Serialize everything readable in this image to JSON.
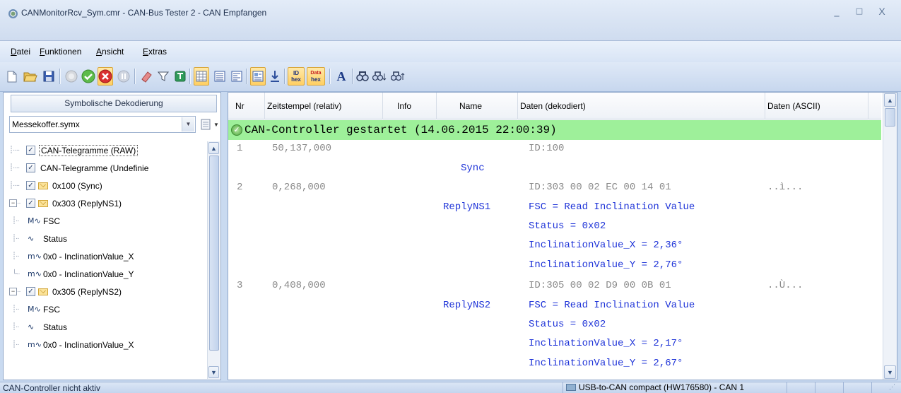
{
  "window": {
    "title": "CANMonitorRcv_Sym.cmr - CAN-Bus Tester 2 - CAN Empfangen",
    "controls": {
      "minimize": "_",
      "maximize": "□",
      "close": "X"
    }
  },
  "menu": {
    "items": [
      {
        "label": "Datei",
        "underline": "D",
        "rest": "atei"
      },
      {
        "label": "Funktionen",
        "underline": "F",
        "rest": "unktionen"
      },
      {
        "label": "Ansicht",
        "underline": "A",
        "rest": "nsicht"
      },
      {
        "label": "Extras",
        "underline": "E",
        "rest": "xtras"
      }
    ]
  },
  "toolbar": {
    "icons": [
      "new-file-icon",
      "open-folder-icon",
      "save-icon",
      "stop-gray-icon",
      "start-green-icon",
      "stop-red-icon",
      "pause-icon",
      "eraser-icon",
      "filter-icon",
      "trigger-icon",
      "grid-icon",
      "list-view-icon",
      "list-view-2-icon",
      "symbolic-icon",
      "scroll-down-icon",
      "id-hex-icon",
      "data-hex-icon",
      "font-icon",
      "find-icon",
      "find-next-icon",
      "find-prev-icon"
    ],
    "id_hex_top": "ID",
    "id_hex_bottom": "hex",
    "data_hex_top": "Data",
    "data_hex_bottom": "hex",
    "font_label": "A"
  },
  "left_panel": {
    "header": "Symbolische Dekodierung",
    "combo_value": "Messekoffer.symx",
    "tree": [
      {
        "label": "CAN-Telegramme (RAW)",
        "checked": true,
        "kind": "check"
      },
      {
        "label": "CAN-Telegramme (Undefinie",
        "checked": true,
        "kind": "check"
      },
      {
        "label": "0x100 (Sync)",
        "checked": true,
        "kind": "msg"
      },
      {
        "label": "0x303 (ReplyNS1)",
        "checked": true,
        "kind": "msg-expanded"
      },
      {
        "label": "FSC",
        "sig": "M∿",
        "kind": "sig"
      },
      {
        "label": "Status",
        "sig": "∿",
        "kind": "sig"
      },
      {
        "label": "0x0 - InclinationValue_X",
        "sig": "m∿",
        "kind": "sig"
      },
      {
        "label": "0x0 - InclinationValue_Y",
        "sig": "m∿",
        "kind": "sig-last"
      },
      {
        "label": "0x305 (ReplyNS2)",
        "checked": true,
        "kind": "msg-expanded"
      },
      {
        "label": "FSC",
        "sig": "M∿",
        "kind": "sig"
      },
      {
        "label": "Status",
        "sig": "∿",
        "kind": "sig"
      },
      {
        "label": "0x0 - InclinationValue_X",
        "sig": "m∿",
        "kind": "sig"
      }
    ]
  },
  "table": {
    "columns": [
      "Nr",
      "Zeitstempel (relativ)",
      "Info",
      "Name",
      "Daten (dekodiert)",
      "Daten (ASCII)"
    ],
    "banner": "CAN-Controller gestartet (14.06.2015  22:00:39)",
    "rows": [
      {
        "nr": "1",
        "time": "50,137,000",
        "data": "ID:100",
        "ascii": ""
      },
      {
        "name": "Sync"
      },
      {
        "nr": "2",
        "time": "0,268,000",
        "data": "ID:303  00 02 EC 00 14 01",
        "ascii": "..ì..."
      },
      {
        "name": "ReplyNS1",
        "decoded": "FSC = Read Inclination Value"
      },
      {
        "decoded": "Status = 0x02"
      },
      {
        "decoded": "InclinationValue_X = 2,36°"
      },
      {
        "decoded": "InclinationValue_Y = 2,76°"
      },
      {
        "nr": "3",
        "time": "0,408,000",
        "data": "ID:305  00 02 D9 00 0B 01",
        "ascii": "..Ù..."
      },
      {
        "name": "ReplyNS2",
        "decoded": "FSC = Read Inclination Value"
      },
      {
        "decoded": "Status = 0x02"
      },
      {
        "decoded": "InclinationValue_X = 2,17°"
      },
      {
        "decoded": "InclinationValue_Y = 2,67°"
      }
    ]
  },
  "status": {
    "left": "CAN-Controller nicht aktiv",
    "right": "USB-to-CAN compact (HW176580) - CAN 1"
  },
  "colors": {
    "banner_bg": "#9ef09a",
    "decoded_text": "#1f34d8",
    "raw_text": "#8a8a8a"
  }
}
